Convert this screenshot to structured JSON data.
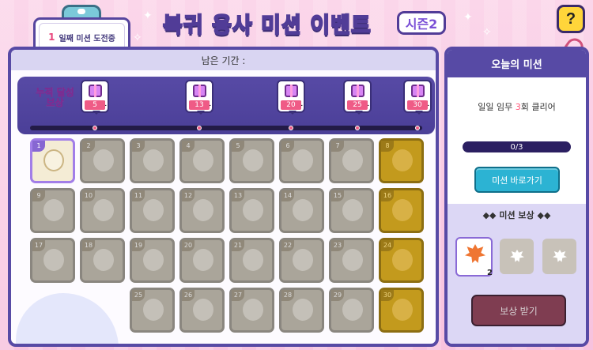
{
  "header": {
    "challenge_day": "1",
    "challenge_text": "일째 미션 도전중",
    "title": "복귀 용사 미션 이벤트",
    "season": "시즌2",
    "help_label": "?"
  },
  "board": {
    "remaining_label": "남은 기간 :",
    "cumulative_label_line1": "누적 달성",
    "cumulative_label_line2": "보상",
    "milestones": [
      {
        "value": "5",
        "count": "1"
      },
      {
        "value": "13",
        "count": "1"
      },
      {
        "value": "20",
        "count": "1"
      },
      {
        "value": "25",
        "count": "1"
      },
      {
        "value": "30",
        "count": "1"
      }
    ],
    "cells": [
      "1",
      "2",
      "3",
      "4",
      "5",
      "6",
      "7",
      "8",
      "9",
      "10",
      "11",
      "12",
      "13",
      "14",
      "15",
      "16",
      "17",
      "18",
      "19",
      "20",
      "21",
      "22",
      "23",
      "24",
      "25",
      "26",
      "27",
      "28",
      "29",
      "30"
    ],
    "gold_cells": [
      8,
      16,
      24,
      30
    ],
    "current_cell": 1
  },
  "today": {
    "title": "오늘의 미션",
    "mission_prefix": "일일 임무 ",
    "mission_count": "3",
    "mission_suffix": "회 클리어",
    "progress_text": "0/3",
    "progress": 0,
    "go_button": "미션 바로가기"
  },
  "rewards": {
    "title": "미션 보상",
    "items": [
      {
        "icon": "maple-leaf-icon",
        "count": "2",
        "active": true
      },
      {
        "icon": "maple-leaf-icon",
        "count": "",
        "active": false
      },
      {
        "icon": "maple-leaf-icon",
        "count": "",
        "active": false
      }
    ],
    "claim_button": "보상 받기"
  }
}
